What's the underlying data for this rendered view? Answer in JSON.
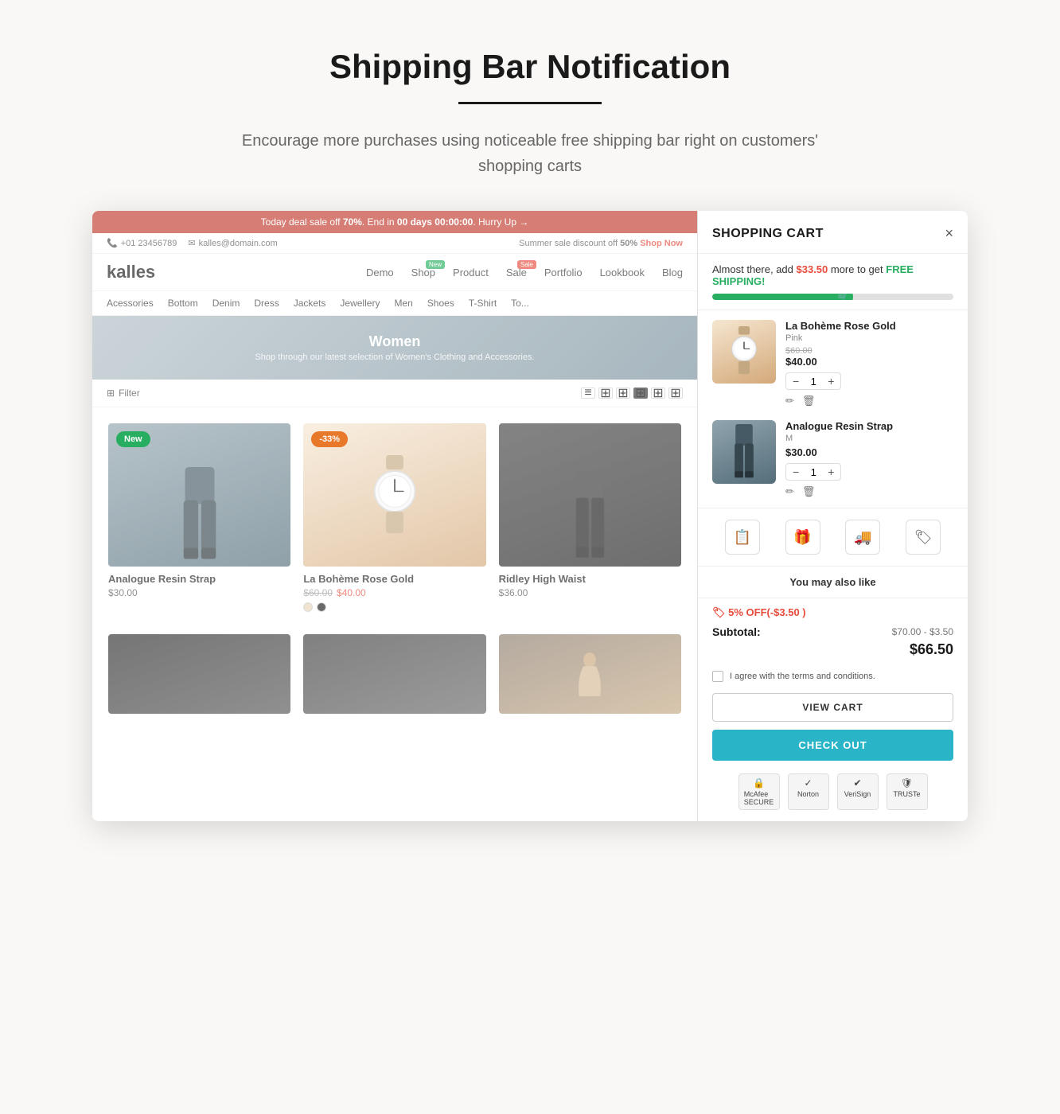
{
  "page": {
    "title": "Shipping Bar Notification",
    "subtitle": "Encourage more purchases using noticeable free shipping bar right on customers' shopping carts",
    "underline": true
  },
  "store": {
    "deal_bar": {
      "text": "Today deal sale off ",
      "percent": "70%",
      "end_text": ". End in ",
      "countdown": "00 days 00:00:00",
      "hurry": "Hurry Up →"
    },
    "summer_bar": {
      "phone": "+01 23456789",
      "email": "kalles@domain.com",
      "promo": "Summer sale discount off ",
      "promo_percent": "50%",
      "shop_now": "Shop Now"
    },
    "logo": "kalles",
    "nav_items": [
      {
        "label": "Demo",
        "badge": null
      },
      {
        "label": "Shop",
        "badge": "New",
        "badge_color": "green"
      },
      {
        "label": "Product",
        "badge": null
      },
      {
        "label": "Sale",
        "badge": "Sale",
        "badge_color": "red"
      },
      {
        "label": "Portfolio",
        "badge": null
      },
      {
        "label": "Lookbook",
        "badge": null
      },
      {
        "label": "Blog",
        "badge": null
      }
    ],
    "categories": [
      "Acessories",
      "Bottom",
      "Denim",
      "Dress",
      "Jackets",
      "Jewellery",
      "Men",
      "Shoes",
      "T-Shirt",
      "To..."
    ],
    "hero": {
      "title": "Women",
      "subtitle": "Shop through our latest selection of Women's Clothing and Accessories."
    },
    "filter_label": "Filter",
    "products": [
      {
        "name": "Analogue Resin Strap",
        "price": "$30.00",
        "old_price": null,
        "badge": "New",
        "badge_color": "green",
        "image_type": "jogger"
      },
      {
        "name": "La Bohème Rose Gold",
        "price": "$40.00",
        "old_price": "$60.00",
        "badge": "-33%",
        "badge_color": "orange",
        "image_type": "watch"
      },
      {
        "name": "Ridley High Waist",
        "price": "$36.00",
        "old_price": null,
        "badge": null,
        "image_type": "pants"
      }
    ]
  },
  "cart": {
    "title": "SHOPPING CART",
    "close_label": "×",
    "shipping": {
      "message_prefix": "Almost there, add ",
      "amount": "$33.50",
      "message_suffix": " more to get ",
      "free_label": "FREE SHIPPING!",
      "progress": 55
    },
    "items": [
      {
        "name": "La Bohème Rose Gold",
        "variant": "Pink",
        "old_price": "$60.00",
        "price": "$40.00",
        "qty": 1,
        "image_type": "watch"
      },
      {
        "name": "Analogue Resin Strap",
        "variant": "M",
        "price": "$30.00",
        "qty": 1,
        "image_type": "jogger"
      }
    ],
    "icons": [
      "clipboard",
      "gift",
      "truck",
      "tag"
    ],
    "also_like": "You may also like",
    "discount": {
      "label": "🏷 5% OFF(-$3.50 )"
    },
    "subtotal": {
      "label": "Subtotal:",
      "calculation": "$70.00 - $3.50",
      "total": "$66.50"
    },
    "terms_text": "I agree with the terms and conditions.",
    "view_cart_label": "VIEW CART",
    "checkout_label": "CHECK OUT",
    "trust_badges": [
      {
        "label": "McAfee SECURE",
        "icon": "🔒"
      },
      {
        "label": "Norton",
        "icon": "✓"
      },
      {
        "label": "VeriSign",
        "icon": "✔"
      },
      {
        "label": "TRUSTe",
        "icon": "🛡"
      }
    ]
  }
}
